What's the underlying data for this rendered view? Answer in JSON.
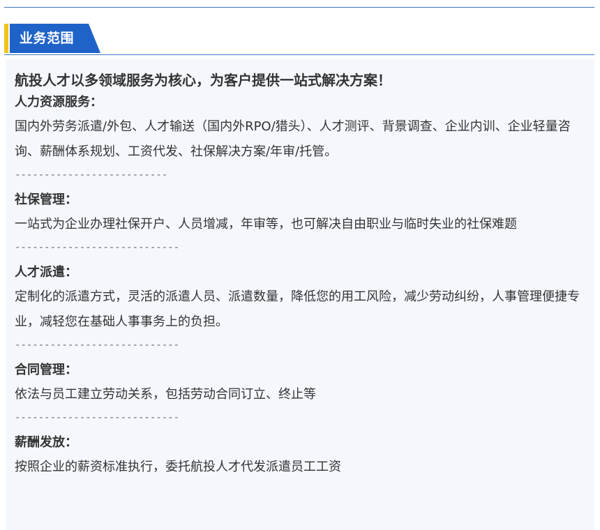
{
  "header": {
    "title": "业务范围"
  },
  "content": {
    "headline": "航投人才以多领域服务为核心，为客户提供一站式解决方案！",
    "sections": [
      {
        "title": "人力资源服务：",
        "body": "国内外劳务派遣/外包、人才输送（国内外RPO/猎头）、人才测评、背景调查、企业内训、企业轻量咨询、薪酬体系规划、工资代发、社保解决方案/年审/托管。",
        "divider": "--------------------------"
      },
      {
        "title": "社保管理：",
        "body": "一站式为企业办理社保开户、人员增减，年审等，也可解决自由职业与临时失业的社保难题",
        "divider": "----------------------------"
      },
      {
        "title": "人才派遣：",
        "body": "定制化的派遣方式，灵活的派遣人员、派遣数量，降低您的用工风险，减少劳动纠纷，人事管理便捷专业，减轻您在基础人事事务上的负担。",
        "divider": "----------------------------"
      },
      {
        "title": "合同管理：",
        "body": "依法与员工建立劳动关系，包括劳动合同订立、终止等",
        "divider": "----------------------------"
      },
      {
        "title": "薪酬发放：",
        "body": "按照企业的薪资标准执行，委托航投人才代发派遣员工工资",
        "divider": ""
      }
    ]
  },
  "colors": {
    "accent_yellow": "#f5c21b",
    "brand_blue": "#1f63c8",
    "rule_blue": "#3f74c4",
    "panel_bg": "#f4f8fd",
    "text": "#333333"
  }
}
